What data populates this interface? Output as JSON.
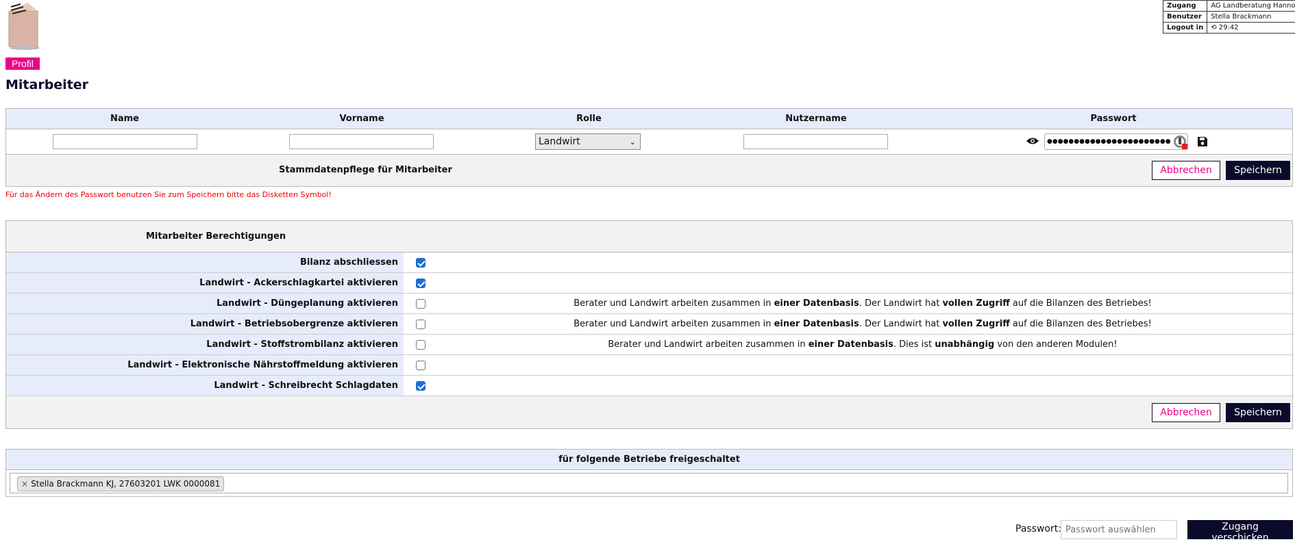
{
  "infobox": {
    "rows": [
      {
        "key": "Zugang",
        "value": "AG Landberatung Hannover"
      },
      {
        "key": "Benutzer",
        "value": "Stella Brackmann"
      },
      {
        "key": "Logout in",
        "value": "29:42"
      }
    ]
  },
  "profil_label": "Profil",
  "page_title": "Mitarbeiter",
  "employee_table": {
    "headers": [
      "Name",
      "Vorname",
      "Rolle",
      "Nutzername",
      "Passwort"
    ],
    "role_selected": "Landwirt",
    "password_mask": "●●●●●●●●●●●●●●●●●●●●●●●",
    "footer_title": "Stammdatenpflege für Mitarbeiter",
    "cancel_label": "Abbrechen",
    "save_label": "Speichern"
  },
  "hint_text": "Für das Ändern des Passwort benutzen Sie zum Speichern bitte das Disketten Symbol!",
  "permissions": {
    "title": "Mitarbeiter Berechtigungen",
    "rows": [
      {
        "label": "Bilanz abschliessen",
        "checked": true
      },
      {
        "label": "Landwirt - Ackerschlagkartei aktivieren",
        "checked": true
      },
      {
        "label": "Landwirt - Düngeplanung aktivieren",
        "checked": false
      },
      {
        "label": "Landwirt - Betriebsobergrenze aktivieren",
        "checked": false
      },
      {
        "label": "Landwirt - Stoffstrombilanz aktivieren",
        "checked": false
      },
      {
        "label": "Landwirt - Elektronische Nährstoffmeldung aktivieren",
        "checked": false
      },
      {
        "label": "Landwirt - Schreibrecht Schlagdaten",
        "checked": true
      }
    ],
    "notes": {
      "row3": {
        "a": "Berater und Landwirt arbeiten zusammen in ",
        "b": "einer Datenbasis",
        "c": ". Der Landwirt hat ",
        "d": "vollen Zugriff",
        "e": " auf die Bilanzen des Betriebes!"
      },
      "row4": {
        "a": "Berater und Landwirt arbeiten zusammen in ",
        "b": "einer Datenbasis",
        "c": ". Der Landwirt hat ",
        "d": "vollen Zugriff",
        "e": " auf die Bilanzen des Betriebes!"
      },
      "row5": {
        "a": "Berater und Landwirt arbeiten zusammen in ",
        "b": "einer Datenbasis",
        "c": ". Dies ist ",
        "d": "unabhängig",
        "e": " von den anderen Modulen!"
      }
    },
    "cancel_label": "Abbrechen",
    "save_label": "Speichern"
  },
  "betriebe": {
    "title": "für folgende Betriebe freigeschaltet",
    "tag_remove": "×",
    "tag_label": "Stella Brackmann KJ, 27603201 LWK 0000081"
  },
  "footer": {
    "password_label": "Passwort:",
    "password_placeholder": "Passwort auswählen",
    "send_label": "Zugang verschicken"
  }
}
